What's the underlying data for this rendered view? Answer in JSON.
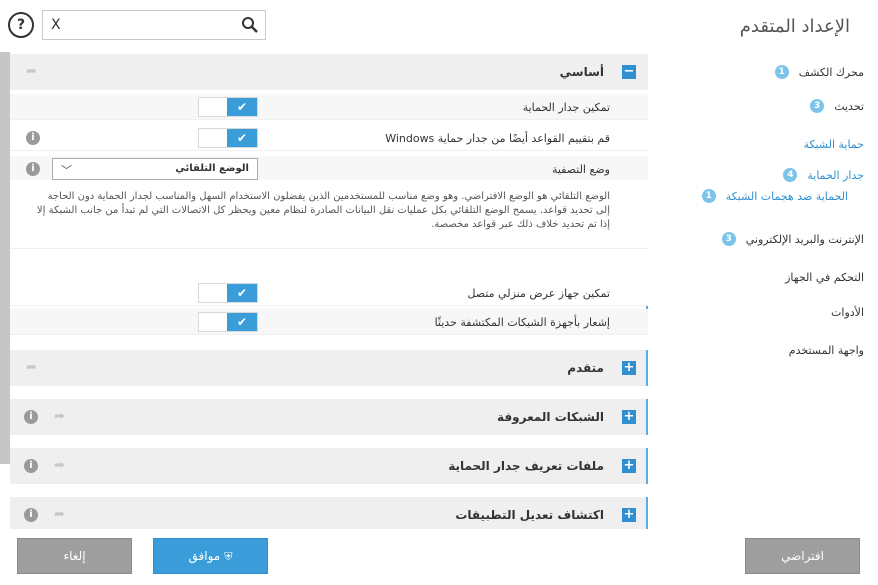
{
  "sidebar": {
    "title": "الإعداد المتقدم",
    "items": [
      {
        "label": "محرك الكشف",
        "badge": "1",
        "link": false
      },
      {
        "label": "تحديث",
        "badge": "3",
        "link": false
      },
      {
        "label": "حماية الشبكة",
        "badge": "",
        "link": true
      },
      {
        "label": "جدار الحماية",
        "badge": "4",
        "link": true
      },
      {
        "label": "الإنترنت والبريد الإلكتروني",
        "badge": "3",
        "link": false
      },
      {
        "label": "التحكم في الجهاز",
        "badge": "",
        "link": false
      },
      {
        "label": "الأدوات",
        "badge": "",
        "link": false
      },
      {
        "label": "واجهة المستخدم",
        "badge": "",
        "link": false
      }
    ],
    "subitem": {
      "label": "الحماية ضد هجمات الشبكة",
      "badge": "1"
    }
  },
  "search": {
    "value": "",
    "clear_glyph": "X"
  },
  "help_glyph": "?",
  "sections": {
    "basic": {
      "label": "أساسي",
      "toggle_glyph": "−"
    },
    "advanced": {
      "label": "متقدم",
      "toggle_glyph": "+"
    },
    "known_networks": {
      "label": "الشبكات المعروفة",
      "toggle_glyph": "+"
    },
    "firewall_profiles": {
      "label": "ملفات تعريف جدار الحماية",
      "toggle_glyph": "+"
    },
    "app_modification": {
      "label": "اكتشاف تعديل التطبيقات",
      "toggle_glyph": "+"
    }
  },
  "settings": {
    "enable_firewall": "تمكين جدار الحماية",
    "evaluate_windows_rules": "قم بتقييم القواعد أيضًا من جدار حماية Windows",
    "filtering_mode_label": "وضع التصفية",
    "filtering_mode_value": "الوضع التلقائي",
    "enable_home_media": "تمكين جهاز عرض منزلي متصل",
    "notify_new_devices": "إشعار بأجهزة الشبكات المكتشفة حديثًا"
  },
  "description": "الوضع التلقائي هو الوضع الافتراضي. وهو وضع مناسب للمستخدمين الذين يفضلون الاستخدام السهل والمناسب لجدار الحماية دون الحاجة إلى تحديد قواعد. يسمح الوضع التلقائي بكل عمليات نقل البيانات الصادرة لنظام معين ويحظر كل الاتصالات التي لم تبدأ من جانب الشبكة إلا إذا تم تحديد خلاف ذلك عبر قواعد مخصصة.",
  "buttons": {
    "cancel": "إلغاء",
    "ok": "موافق",
    "default": "افتراضي"
  },
  "colors": {
    "accent": "#3a9cd8",
    "badge": "#7cc4ea"
  }
}
